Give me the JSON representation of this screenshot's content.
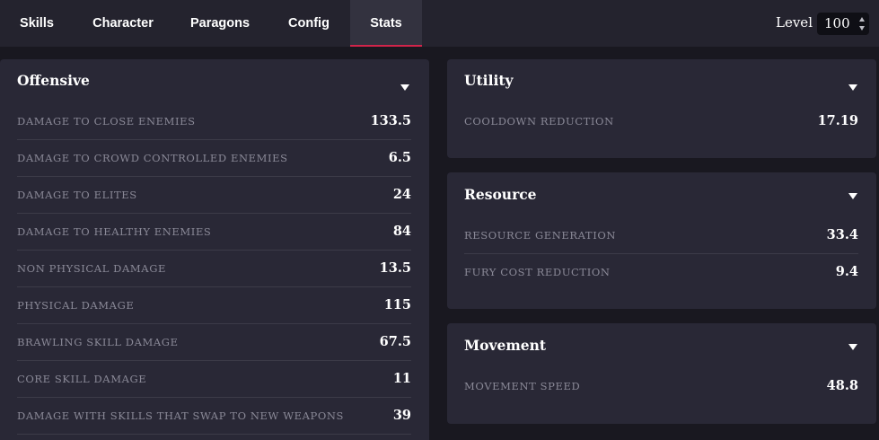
{
  "nav": {
    "tabs": [
      {
        "label": "Skills"
      },
      {
        "label": "Character"
      },
      {
        "label": "Paragons"
      },
      {
        "label": "Config"
      },
      {
        "label": "Stats"
      }
    ],
    "active_tab": "Stats",
    "accent_color": "#d1244a",
    "level_label": "Level",
    "level_value": "100"
  },
  "panels": {
    "offensive": {
      "title": "Offensive",
      "rows": [
        {
          "label": "DAMAGE TO CLOSE ENEMIES",
          "value": "133.5"
        },
        {
          "label": "DAMAGE TO CROWD CONTROLLED ENEMIES",
          "value": "6.5"
        },
        {
          "label": "DAMAGE TO ELITES",
          "value": "24"
        },
        {
          "label": "DAMAGE TO HEALTHY ENEMIES",
          "value": "84"
        },
        {
          "label": "NON PHYSICAL DAMAGE",
          "value": "13.5"
        },
        {
          "label": "PHYSICAL DAMAGE",
          "value": "115"
        },
        {
          "label": "BRAWLING SKILL DAMAGE",
          "value": "67.5"
        },
        {
          "label": "CORE SKILL DAMAGE",
          "value": "11"
        },
        {
          "label": "DAMAGE WITH SKILLS THAT SWAP TO NEW WEAPONS",
          "value": "39"
        }
      ]
    },
    "utility": {
      "title": "Utility",
      "rows": [
        {
          "label": "COOLDOWN REDUCTION",
          "value": "17.19"
        }
      ]
    },
    "resource": {
      "title": "Resource",
      "rows": [
        {
          "label": "RESOURCE GENERATION",
          "value": "33.4"
        },
        {
          "label": "FURY COST REDUCTION",
          "value": "9.4"
        }
      ]
    },
    "movement": {
      "title": "Movement",
      "rows": [
        {
          "label": "MOVEMENT SPEED",
          "value": "48.8"
        }
      ]
    }
  }
}
